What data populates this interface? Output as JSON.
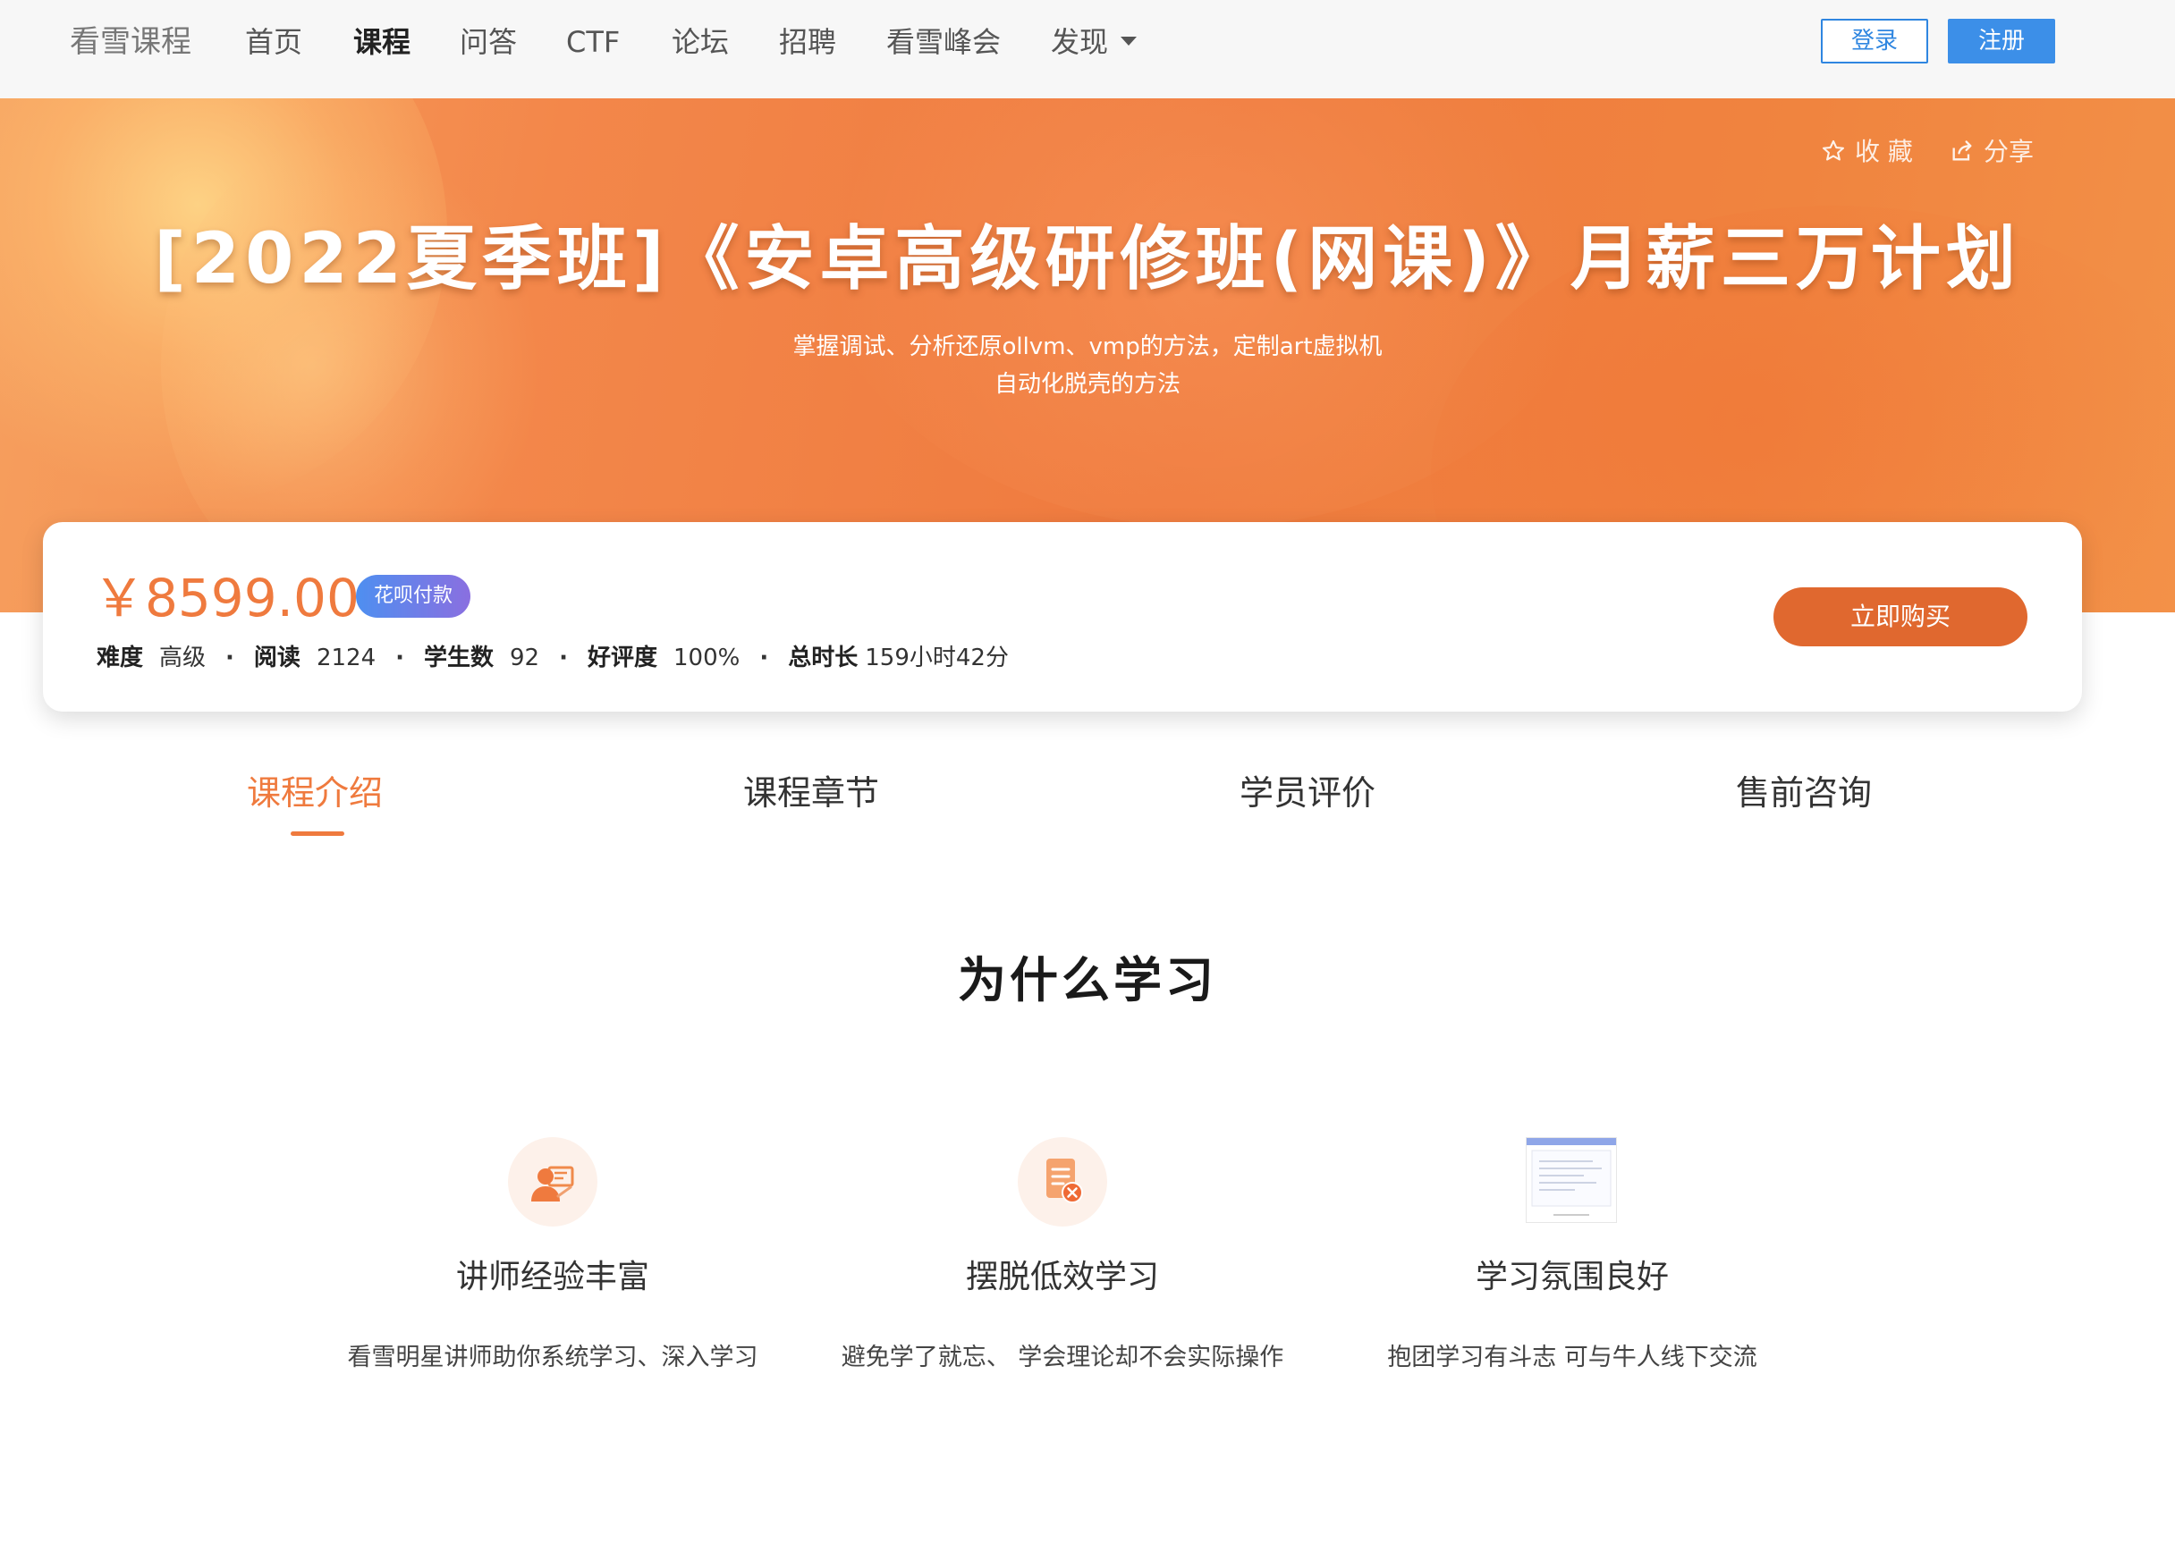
{
  "nav": {
    "brand": "看雪课程",
    "items": [
      {
        "label": "首页"
      },
      {
        "label": "课程"
      },
      {
        "label": "问答"
      },
      {
        "label": "CTF"
      },
      {
        "label": "论坛"
      },
      {
        "label": "招聘"
      },
      {
        "label": "看雪峰会"
      },
      {
        "label": "发现"
      }
    ],
    "active_item": "课程",
    "login_label": "登录",
    "register_label": "注册"
  },
  "hero": {
    "favorite_label": "收 藏",
    "share_label": "分享",
    "title": "[2022夏季班]《安卓高级研修班(网课)》月薪三万计划",
    "subtitle_line1": "掌握调试、分析还原ollvm、vmp的方法，定制art虚拟机",
    "subtitle_line2": "自动化脱壳的方法"
  },
  "course": {
    "price": "￥8599.00",
    "payment_badge": "花呗付款",
    "difficulty_label": "难度",
    "difficulty": "高级",
    "reads_label": "阅读",
    "reads": "2124",
    "students_label": "学生数",
    "students": "92",
    "rating_label": "好评度",
    "rating": "100%",
    "duration_label": "总时长",
    "duration": "159小时42分",
    "buy_label": "立即购买"
  },
  "tabs": [
    {
      "label": "课程介绍"
    },
    {
      "label": "课程章节"
    },
    {
      "label": "学员评价"
    },
    {
      "label": "售前咨询"
    }
  ],
  "active_tab": "课程介绍",
  "why": {
    "title": "为什么学习",
    "features": [
      {
        "title": "讲师经验丰富",
        "description": "看雪明星讲师助你系统学习、深入学习",
        "icon": "teacher-icon"
      },
      {
        "title": "摆脱低效学习",
        "description": "避免学了就忘、 学会理论却不会实际操作",
        "icon": "document-cancel-icon"
      },
      {
        "title": "学习氛围良好",
        "description": "抱团学习有斗志 可与牛人线下交流",
        "icon": "screenshot-thumbnail"
      }
    ]
  },
  "colors": {
    "accent": "#ef7a3e",
    "buy_button": "#e0682f",
    "login_blue": "#2f86e0",
    "register_blue": "#3c8fe8"
  }
}
